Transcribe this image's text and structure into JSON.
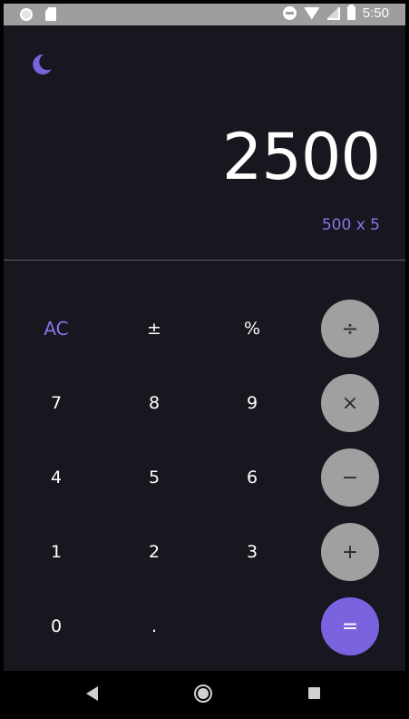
{
  "status_bar": {
    "time": "5:50",
    "icons": [
      "notification-dot-icon",
      "sd-card-icon",
      "do-not-disturb-icon",
      "wifi-icon",
      "signal-icon",
      "battery-icon"
    ]
  },
  "theme": {
    "icon": "moon-icon",
    "accent": "#7b63e0",
    "background": "#17171f",
    "operator_bg": "#a0a0a0"
  },
  "display": {
    "value": "2500",
    "expression": "500 x 5"
  },
  "keypad": {
    "rows": [
      [
        "AC",
        "±",
        "%",
        "÷"
      ],
      [
        "7",
        "8",
        "9",
        "×"
      ],
      [
        "4",
        "5",
        "6",
        "−"
      ],
      [
        "1",
        "2",
        "3",
        "+"
      ],
      [
        "0",
        ".",
        "",
        "="
      ]
    ]
  },
  "nav_bar": {
    "icons": [
      "back-icon",
      "home-icon",
      "recents-icon"
    ]
  }
}
